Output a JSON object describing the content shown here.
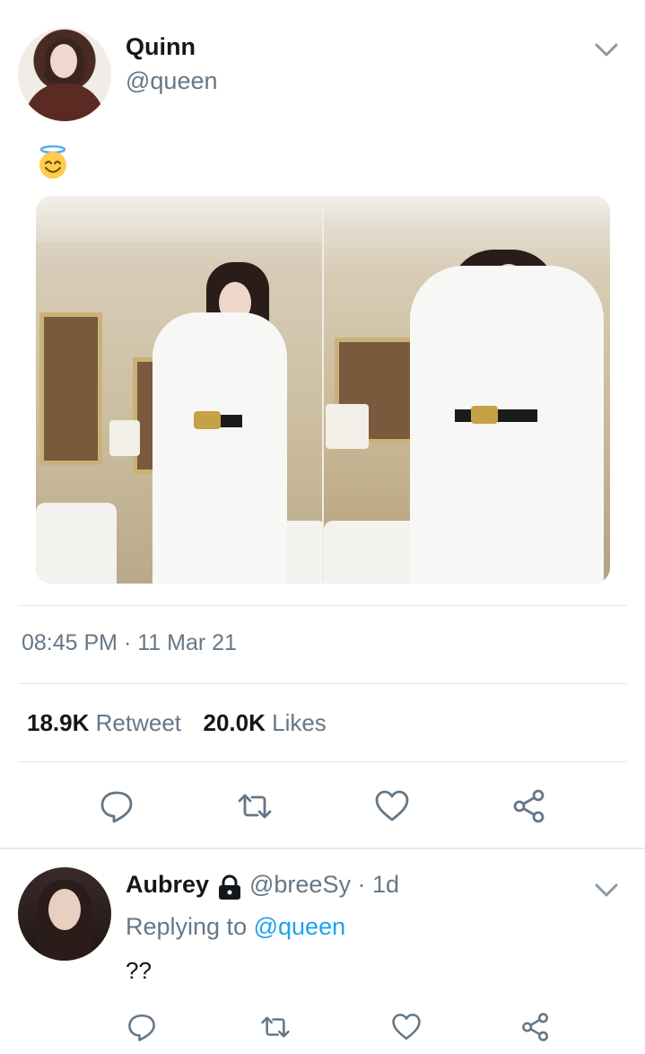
{
  "tweet": {
    "author_name": "Quinn",
    "author_handle": "@queen",
    "text_emoji": "😇",
    "timestamp": "08:45 PM · 11 Mar 21",
    "retweets_count": "18.9K",
    "retweets_label": "Retweet",
    "likes_count": "20.0K",
    "likes_label": "Likes"
  },
  "reply": {
    "author_name": "Aubrey",
    "author_handle": "@breeSy",
    "time_ago": "· 1d",
    "replying_prefix": "Replying to",
    "replying_to": "@queen",
    "text": "??"
  },
  "icons": [
    "chevron-down-icon",
    "reply-icon",
    "retweet-icon",
    "like-icon",
    "share-icon",
    "lock-icon"
  ],
  "colors": {
    "secondary_text": "#657786",
    "link": "#1da1f2",
    "icon": "#657786",
    "divider": "#e1e8ed"
  }
}
